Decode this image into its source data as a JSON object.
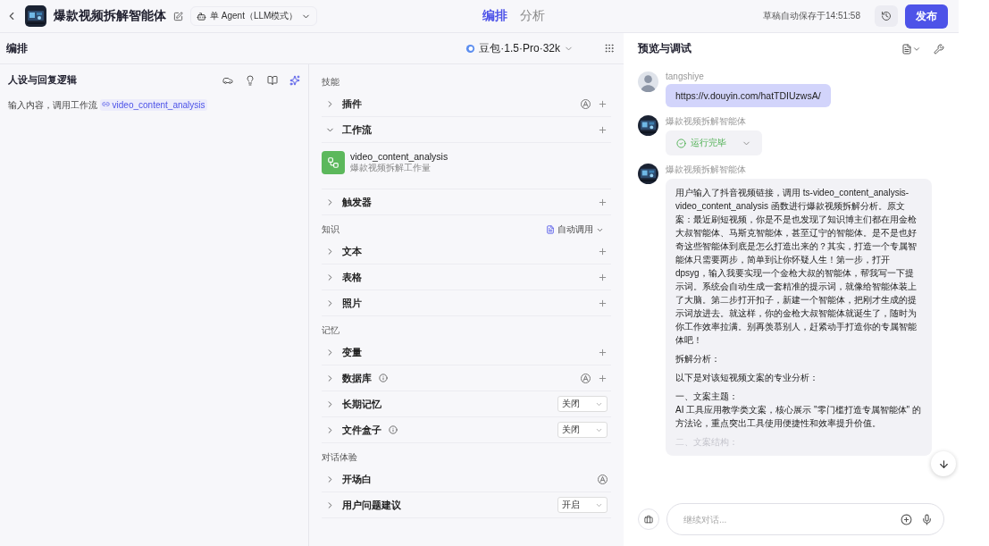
{
  "header": {
    "title": "爆款视频拆解智能体",
    "agent_mode": "单 Agent（LLM模式）",
    "tabs": [
      {
        "label": "编排",
        "selected": true
      },
      {
        "label": "分析",
        "selected": false
      }
    ],
    "autosave": "草稿自动保存于14:51:58",
    "publish": "发布"
  },
  "subheader": {
    "title": "编排",
    "model": "豆包·1.5·Pro·32k"
  },
  "persona": {
    "title": "人设与回复逻辑",
    "prompt_text": "输入内容，调用工作流",
    "prompt_ref": "video_content_analysis"
  },
  "groups": [
    {
      "title": "技能",
      "items": [
        {
          "label": "插件",
          "expanded": false,
          "auto": true,
          "add": true
        },
        {
          "label": "工作流",
          "expanded": true,
          "add": true,
          "children": [
            {
              "name": "video_content_analysis",
              "desc": "爆款视频拆解工作量"
            }
          ]
        },
        {
          "label": "触发器",
          "expanded": false,
          "add": true
        }
      ]
    },
    {
      "title": "知识",
      "action": "自动调用",
      "items": [
        {
          "label": "文本",
          "expanded": false,
          "add": true
        },
        {
          "label": "表格",
          "expanded": false,
          "add": true
        },
        {
          "label": "照片",
          "expanded": false,
          "add": true
        }
      ]
    },
    {
      "title": "记忆",
      "items": [
        {
          "label": "变量",
          "expanded": false,
          "add": true
        },
        {
          "label": "数据库",
          "expanded": false,
          "info": true,
          "auto": true,
          "add": true
        },
        {
          "label": "长期记忆",
          "expanded": false,
          "select": "关闭"
        },
        {
          "label": "文件盒子",
          "expanded": false,
          "info": true,
          "select": "关闭"
        }
      ]
    },
    {
      "title": "对话体验",
      "items": [
        {
          "label": "开场白",
          "expanded": false,
          "auto": true
        },
        {
          "label": "用户问题建议",
          "expanded": false,
          "select": "开启"
        }
      ]
    }
  ],
  "preview": {
    "title": "预览与调试",
    "messages": [
      {
        "kind": "user",
        "sender": "tangshiye",
        "text": "https://v.douyin.com/hatTDIUzwsA/"
      },
      {
        "kind": "status",
        "sender": "爆款视频拆解智能体",
        "text": "运行完毕"
      },
      {
        "kind": "answer",
        "sender": "爆款视频拆解智能体",
        "paragraphs": [
          {
            "text": "用户输入了抖音视频链接，调用 ts-video_content_analysis-video_content_analysis 函数进行爆款视频拆解分析。原文案：最近刷短视频，你是不是也发现了知识博主们都在用金枪大叔智能体、马斯克智能体，甚至辽宁的智能体。是不是也好奇这些智能体到底是怎么打造出来的？其实，打造一个专属智能体只需要两步，简单到让你怀疑人生！第一步，打开 dpsyg，输入我要实现一个金枪大叔的智能体，帮我写一下提示词。系统会自动生成一套精准的提示词，就像给智能体装上了大脑。第二步打开扣子，新建一个智能体，把刚才生成的提示词放进去。就这样，你的金枪大叔智能体就诞生了，随时为你工作效率拉满。别再羡慕别人，赶紧动手打造你的专属智能体吧！",
            "faded": false
          },
          {
            "text": "拆解分析：",
            "faded": false
          },
          {
            "text": "以下是对该短视频文案的专业分析：",
            "faded": false
          },
          {
            "text": "一、文案主题：",
            "faded": false
          },
          {
            "text": "AI 工具应用教学类文案，核心展示 \"零门槛打造专属智能体\" 的方法论，重点突出工具使用便捷性和效率提升价值。",
            "faded": false,
            "tight": true
          },
          {
            "text": "二、文案结构：",
            "faded": true
          }
        ]
      }
    ],
    "input_placeholder": "继续对话..."
  }
}
